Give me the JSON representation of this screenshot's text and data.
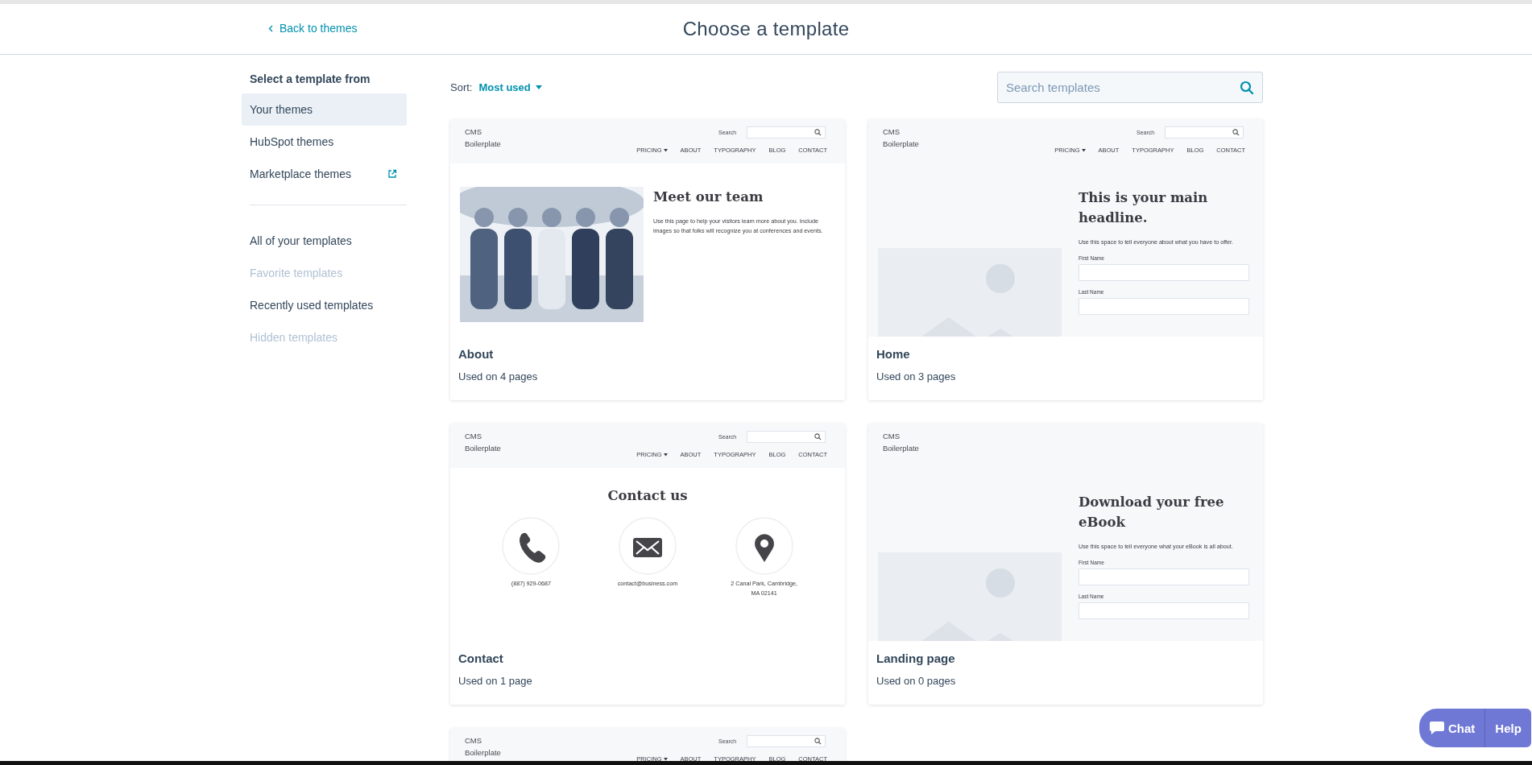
{
  "header": {
    "back_link": "Back to themes",
    "title": "Choose a template"
  },
  "sidebar": {
    "heading": "Select a template from",
    "groups": [
      [
        {
          "label": "Your themes",
          "selected": true,
          "disabled": false,
          "kind": "link"
        },
        {
          "label": "HubSpot themes",
          "selected": false,
          "disabled": false,
          "kind": "link"
        },
        {
          "label": "Marketplace themes",
          "selected": false,
          "disabled": false,
          "kind": "external"
        }
      ],
      [
        {
          "label": "All of your templates",
          "selected": false,
          "disabled": false,
          "kind": "link"
        },
        {
          "label": "Favorite templates",
          "selected": false,
          "disabled": true,
          "kind": "link"
        },
        {
          "label": "Recently used templates",
          "selected": false,
          "disabled": false,
          "kind": "link"
        },
        {
          "label": "Hidden templates",
          "selected": false,
          "disabled": true,
          "kind": "link"
        }
      ]
    ]
  },
  "sort": {
    "label": "Sort:",
    "value": "Most used"
  },
  "search": {
    "placeholder": "Search templates"
  },
  "templates": [
    {
      "name": "About",
      "usage": "Used on 4 pages",
      "preview": {
        "kind": "team",
        "header": {
          "site_name": "CMS Boilerplate",
          "search_label": "Search",
          "nav": [
            {
              "label": "PRICING",
              "dropdown": true
            },
            {
              "label": "ABOUT",
              "dropdown": false
            },
            {
              "label": "TYPOGRAPHY",
              "dropdown": false
            },
            {
              "label": "BLOG",
              "dropdown": false
            },
            {
              "label": "CONTACT",
              "dropdown": false
            }
          ]
        },
        "headline": "Meet our team",
        "body": "Use this page to help your visitors learn more about you. Include images so that folks will recognize you at conferences and events."
      }
    },
    {
      "name": "Home",
      "usage": "Used on 3 pages",
      "preview": {
        "kind": "form",
        "header": {
          "site_name": "CMS Boilerplate",
          "search_label": "Search",
          "nav": [
            {
              "label": "PRICING",
              "dropdown": true
            },
            {
              "label": "ABOUT",
              "dropdown": false
            },
            {
              "label": "TYPOGRAPHY",
              "dropdown": false
            },
            {
              "label": "BLOG",
              "dropdown": false
            },
            {
              "label": "CONTACT",
              "dropdown": false
            }
          ]
        },
        "headline": "This is your main headline.",
        "body": "Use this space to tell everyone about what you have to offer.",
        "fields": [
          {
            "label": "First Name"
          },
          {
            "label": "Last Name"
          }
        ]
      }
    },
    {
      "name": "Contact",
      "usage": "Used on 1 page",
      "preview": {
        "kind": "contact",
        "header": {
          "site_name": "CMS Boilerplate",
          "search_label": "Search",
          "nav": [
            {
              "label": "PRICING",
              "dropdown": true
            },
            {
              "label": "ABOUT",
              "dropdown": false
            },
            {
              "label": "TYPOGRAPHY",
              "dropdown": false
            },
            {
              "label": "BLOG",
              "dropdown": false
            },
            {
              "label": "CONTACT",
              "dropdown": false
            }
          ]
        },
        "headline": "Contact us",
        "items": [
          {
            "kind": "phone",
            "text": "(887) 929-0687"
          },
          {
            "kind": "email",
            "text": "contact@business.com"
          },
          {
            "kind": "location",
            "text": "2 Canal Park, Cambridge, MA 02141"
          }
        ]
      }
    },
    {
      "name": "Landing page",
      "usage": "Used on 0 pages",
      "preview": {
        "kind": "form",
        "header": {
          "site_name": "CMS Boilerplate"
        },
        "headline": "Download your free eBook",
        "body": "Use this space to tell everyone what your eBook is all about.",
        "fields": [
          {
            "label": "First Name"
          },
          {
            "label": "Last Name"
          }
        ]
      }
    },
    {
      "preview": {
        "kind": "header_only",
        "header": {
          "site_name": "CMS Boilerplate",
          "search_label": "Search",
          "nav": [
            {
              "label": "PRICING",
              "dropdown": true
            },
            {
              "label": "ABOUT",
              "dropdown": false
            },
            {
              "label": "TYPOGRAPHY",
              "dropdown": false
            },
            {
              "label": "BLOG",
              "dropdown": false
            },
            {
              "label": "CONTACT",
              "dropdown": false
            }
          ]
        }
      }
    }
  ],
  "chat_widget": {
    "chat": "Chat",
    "help": "Help"
  }
}
